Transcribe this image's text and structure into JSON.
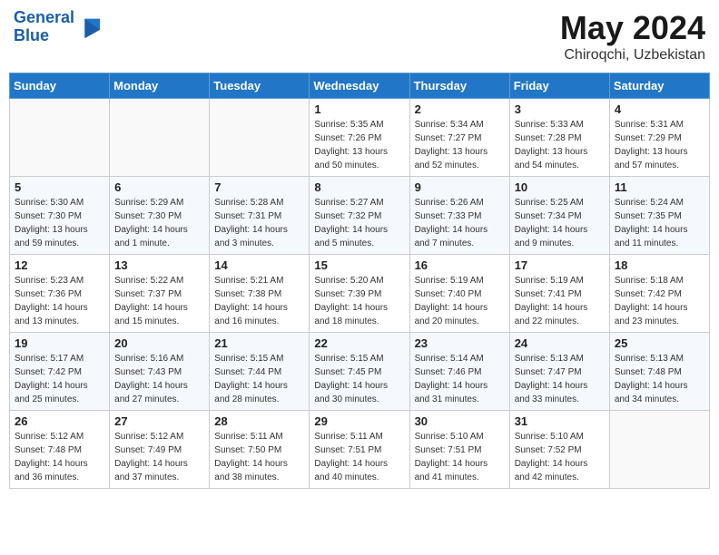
{
  "header": {
    "logo_line1": "General",
    "logo_line2": "Blue",
    "month": "May 2024",
    "location": "Chiroqchi, Uzbekistan"
  },
  "weekdays": [
    "Sunday",
    "Monday",
    "Tuesday",
    "Wednesday",
    "Thursday",
    "Friday",
    "Saturday"
  ],
  "weeks": [
    [
      {
        "day": "",
        "sunrise": "",
        "sunset": "",
        "daylight": ""
      },
      {
        "day": "",
        "sunrise": "",
        "sunset": "",
        "daylight": ""
      },
      {
        "day": "",
        "sunrise": "",
        "sunset": "",
        "daylight": ""
      },
      {
        "day": "1",
        "sunrise": "Sunrise: 5:35 AM",
        "sunset": "Sunset: 7:26 PM",
        "daylight": "Daylight: 13 hours and 50 minutes."
      },
      {
        "day": "2",
        "sunrise": "Sunrise: 5:34 AM",
        "sunset": "Sunset: 7:27 PM",
        "daylight": "Daylight: 13 hours and 52 minutes."
      },
      {
        "day": "3",
        "sunrise": "Sunrise: 5:33 AM",
        "sunset": "Sunset: 7:28 PM",
        "daylight": "Daylight: 13 hours and 54 minutes."
      },
      {
        "day": "4",
        "sunrise": "Sunrise: 5:31 AM",
        "sunset": "Sunset: 7:29 PM",
        "daylight": "Daylight: 13 hours and 57 minutes."
      }
    ],
    [
      {
        "day": "5",
        "sunrise": "Sunrise: 5:30 AM",
        "sunset": "Sunset: 7:30 PM",
        "daylight": "Daylight: 13 hours and 59 minutes."
      },
      {
        "day": "6",
        "sunrise": "Sunrise: 5:29 AM",
        "sunset": "Sunset: 7:30 PM",
        "daylight": "Daylight: 14 hours and 1 minute."
      },
      {
        "day": "7",
        "sunrise": "Sunrise: 5:28 AM",
        "sunset": "Sunset: 7:31 PM",
        "daylight": "Daylight: 14 hours and 3 minutes."
      },
      {
        "day": "8",
        "sunrise": "Sunrise: 5:27 AM",
        "sunset": "Sunset: 7:32 PM",
        "daylight": "Daylight: 14 hours and 5 minutes."
      },
      {
        "day": "9",
        "sunrise": "Sunrise: 5:26 AM",
        "sunset": "Sunset: 7:33 PM",
        "daylight": "Daylight: 14 hours and 7 minutes."
      },
      {
        "day": "10",
        "sunrise": "Sunrise: 5:25 AM",
        "sunset": "Sunset: 7:34 PM",
        "daylight": "Daylight: 14 hours and 9 minutes."
      },
      {
        "day": "11",
        "sunrise": "Sunrise: 5:24 AM",
        "sunset": "Sunset: 7:35 PM",
        "daylight": "Daylight: 14 hours and 11 minutes."
      }
    ],
    [
      {
        "day": "12",
        "sunrise": "Sunrise: 5:23 AM",
        "sunset": "Sunset: 7:36 PM",
        "daylight": "Daylight: 14 hours and 13 minutes."
      },
      {
        "day": "13",
        "sunrise": "Sunrise: 5:22 AM",
        "sunset": "Sunset: 7:37 PM",
        "daylight": "Daylight: 14 hours and 15 minutes."
      },
      {
        "day": "14",
        "sunrise": "Sunrise: 5:21 AM",
        "sunset": "Sunset: 7:38 PM",
        "daylight": "Daylight: 14 hours and 16 minutes."
      },
      {
        "day": "15",
        "sunrise": "Sunrise: 5:20 AM",
        "sunset": "Sunset: 7:39 PM",
        "daylight": "Daylight: 14 hours and 18 minutes."
      },
      {
        "day": "16",
        "sunrise": "Sunrise: 5:19 AM",
        "sunset": "Sunset: 7:40 PM",
        "daylight": "Daylight: 14 hours and 20 minutes."
      },
      {
        "day": "17",
        "sunrise": "Sunrise: 5:19 AM",
        "sunset": "Sunset: 7:41 PM",
        "daylight": "Daylight: 14 hours and 22 minutes."
      },
      {
        "day": "18",
        "sunrise": "Sunrise: 5:18 AM",
        "sunset": "Sunset: 7:42 PM",
        "daylight": "Daylight: 14 hours and 23 minutes."
      }
    ],
    [
      {
        "day": "19",
        "sunrise": "Sunrise: 5:17 AM",
        "sunset": "Sunset: 7:42 PM",
        "daylight": "Daylight: 14 hours and 25 minutes."
      },
      {
        "day": "20",
        "sunrise": "Sunrise: 5:16 AM",
        "sunset": "Sunset: 7:43 PM",
        "daylight": "Daylight: 14 hours and 27 minutes."
      },
      {
        "day": "21",
        "sunrise": "Sunrise: 5:15 AM",
        "sunset": "Sunset: 7:44 PM",
        "daylight": "Daylight: 14 hours and 28 minutes."
      },
      {
        "day": "22",
        "sunrise": "Sunrise: 5:15 AM",
        "sunset": "Sunset: 7:45 PM",
        "daylight": "Daylight: 14 hours and 30 minutes."
      },
      {
        "day": "23",
        "sunrise": "Sunrise: 5:14 AM",
        "sunset": "Sunset: 7:46 PM",
        "daylight": "Daylight: 14 hours and 31 minutes."
      },
      {
        "day": "24",
        "sunrise": "Sunrise: 5:13 AM",
        "sunset": "Sunset: 7:47 PM",
        "daylight": "Daylight: 14 hours and 33 minutes."
      },
      {
        "day": "25",
        "sunrise": "Sunrise: 5:13 AM",
        "sunset": "Sunset: 7:48 PM",
        "daylight": "Daylight: 14 hours and 34 minutes."
      }
    ],
    [
      {
        "day": "26",
        "sunrise": "Sunrise: 5:12 AM",
        "sunset": "Sunset: 7:48 PM",
        "daylight": "Daylight: 14 hours and 36 minutes."
      },
      {
        "day": "27",
        "sunrise": "Sunrise: 5:12 AM",
        "sunset": "Sunset: 7:49 PM",
        "daylight": "Daylight: 14 hours and 37 minutes."
      },
      {
        "day": "28",
        "sunrise": "Sunrise: 5:11 AM",
        "sunset": "Sunset: 7:50 PM",
        "daylight": "Daylight: 14 hours and 38 minutes."
      },
      {
        "day": "29",
        "sunrise": "Sunrise: 5:11 AM",
        "sunset": "Sunset: 7:51 PM",
        "daylight": "Daylight: 14 hours and 40 minutes."
      },
      {
        "day": "30",
        "sunrise": "Sunrise: 5:10 AM",
        "sunset": "Sunset: 7:51 PM",
        "daylight": "Daylight: 14 hours and 41 minutes."
      },
      {
        "day": "31",
        "sunrise": "Sunrise: 5:10 AM",
        "sunset": "Sunset: 7:52 PM",
        "daylight": "Daylight: 14 hours and 42 minutes."
      },
      {
        "day": "",
        "sunrise": "",
        "sunset": "",
        "daylight": ""
      }
    ]
  ]
}
